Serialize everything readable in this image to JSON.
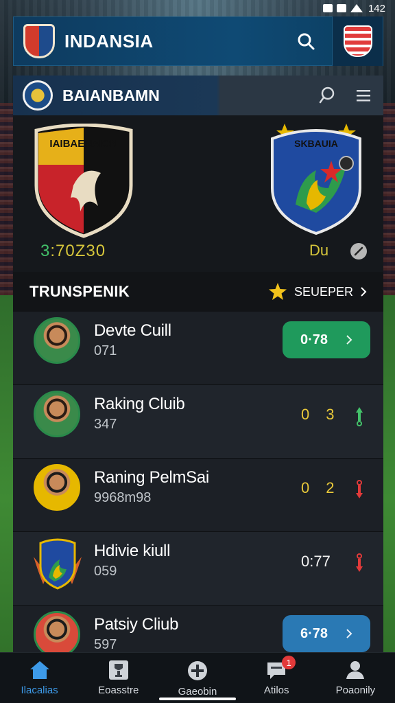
{
  "status_bar": {
    "time": "142"
  },
  "header": {
    "title": "INDANSIA",
    "logo_text": "INDANSIA"
  },
  "sub_header": {
    "title": "BAIANBAMN"
  },
  "match": {
    "home_crest_text": "IAIBAENAION",
    "away_crest_text": "SKBAUIA",
    "home_score_first": "3",
    "home_score_rest": ":70Z30",
    "away_score": "Du"
  },
  "section": {
    "title": "TRUNSPENIK",
    "link_label": "SEUEPER"
  },
  "rows": [
    {
      "name": "Devte Cuill",
      "sub": "071",
      "pill": "0·78",
      "type": "pill-green"
    },
    {
      "name": "Raking Cluib",
      "sub": "347",
      "score_a": "0",
      "score_b": "3",
      "trend": "up"
    },
    {
      "name": "Raning PelmSai",
      "sub": "9968m98",
      "score_a": "0",
      "score_b": "2",
      "trend": "down"
    },
    {
      "name": "Hdivie kiull",
      "sub": "059",
      "score_single": "0:77",
      "trend": "down"
    },
    {
      "name": "Patsiy Cliub",
      "sub": "597",
      "pill": "6·78",
      "type": "pill-blue"
    }
  ],
  "nav": [
    {
      "label": "Ilacalias",
      "icon": "home-icon",
      "active": true
    },
    {
      "label": "Eoasstre",
      "icon": "trophy-icon"
    },
    {
      "label": "Gaeobin",
      "icon": "plus-icon"
    },
    {
      "label": "Atilos",
      "icon": "chat-icon",
      "badge": "1"
    },
    {
      "label": "Poaonily",
      "icon": "profile-icon"
    }
  ],
  "colors": {
    "accent_green": "#1f9a5c",
    "accent_blue": "#2a79b4",
    "header_blue": "#0f4a74",
    "score_yellow": "#e9c93a",
    "trend_green": "#43c26a",
    "trend_red": "#e23a3a"
  }
}
